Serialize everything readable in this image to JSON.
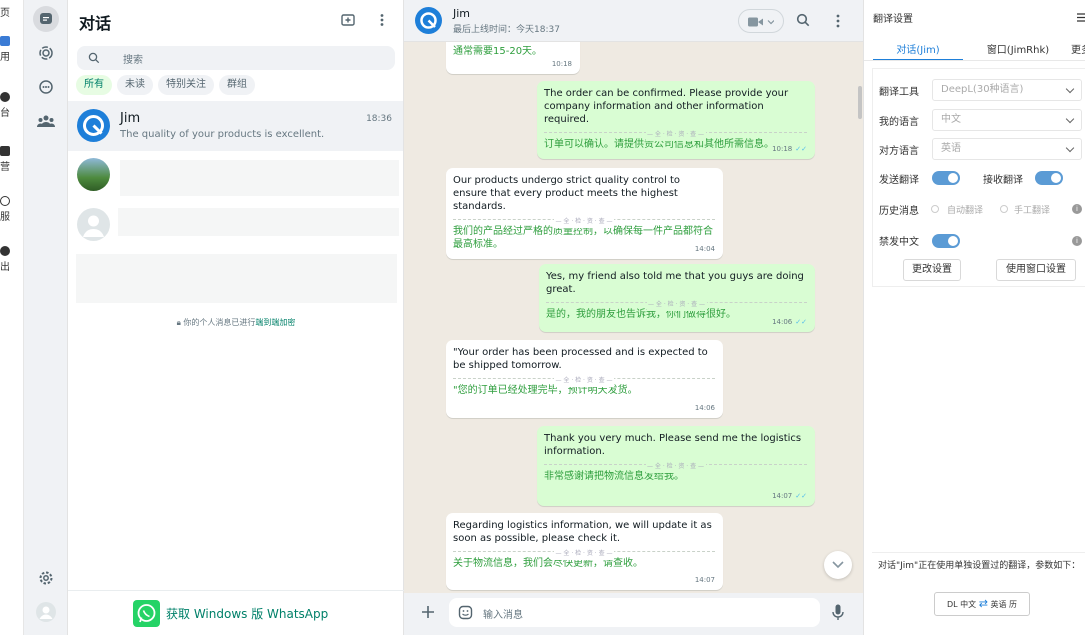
{
  "left_nav": {
    "items": [
      {
        "label": "页"
      },
      {
        "label": "用"
      },
      {
        "label": "台"
      },
      {
        "label": "营"
      },
      {
        "label": "服"
      },
      {
        "label": "出"
      }
    ]
  },
  "chat_list": {
    "title": "对话",
    "search_placeholder": "搜索",
    "filters": [
      "所有",
      "未读",
      "特别关注",
      "群组"
    ],
    "chats": [
      {
        "name": "Jim",
        "time": "18:36",
        "preview": "The quality of your products is excellent."
      }
    ],
    "encryption_note": "你的个人消息已进行",
    "encryption_link": "端到端加密",
    "download_label": "获取 Windows 版 WhatsApp"
  },
  "chat_header": {
    "name": "Jim",
    "status": "最后上线时间：今天18:37"
  },
  "messages": [
    {
      "dir": "in",
      "text": "",
      "translation": "通常需要15-20天。",
      "time": "10:18"
    },
    {
      "dir": "out",
      "text": "The order can be confirmed. Please provide your company information and other information required.",
      "translation": "订单可以确认。请提供贵公司信息和其他所需信息。",
      "time": "10:18"
    },
    {
      "dir": "in",
      "text": "Our products undergo strict quality control to ensure that every product meets the highest standards.",
      "translation": "我们的产品经过严格的质量控制，以确保每一件产品都符合最高标准。",
      "time": "14:04"
    },
    {
      "dir": "out",
      "text": "Yes, my friend also told me that you guys are doing great.",
      "translation": "是的，我的朋友也告诉我，你们做得很好。",
      "time": "14:06"
    },
    {
      "dir": "in",
      "text": "\"Your order has been processed and is expected to be shipped tomorrow.",
      "translation": "\"您的订单已经处理完毕，预计明天发货。",
      "time": "14:06"
    },
    {
      "dir": "out",
      "text": "Thank you very much. Please send me the logistics information.",
      "translation": "非常感谢请把物流信息发给我。",
      "time": "14:07"
    },
    {
      "dir": "in",
      "text": "Regarding logistics information, we will update it as soon as possible, please check it.",
      "translation": "关于物流信息，我们会尽快更新，请查收。",
      "time": "14:07"
    }
  ],
  "sep_label": "— 全 · 检 · 资 · 查 —",
  "compose": {
    "placeholder": "输入消息"
  },
  "translate_panel": {
    "title": "翻译设置",
    "tabs": [
      "对话(Jim)",
      "窗口(JimRhk)",
      "更多"
    ],
    "tool_label": "翻译工具",
    "tool_value": "DeepL(30种语言)",
    "my_lang_label": "我的语言",
    "my_lang_value": "中文",
    "their_lang_label": "对方语言",
    "their_lang_value": "英语",
    "send_translate_label": "发送翻译",
    "recv_translate_label": "接收翻译",
    "history_label": "历史消息",
    "auto_label": "自动翻译",
    "manual_label": "手工翻译",
    "ban_cn_label": "禁发中文",
    "change_btn": "更改设置",
    "use_window_btn": "使用窗口设置",
    "footer_note": "对话\"Jim\"正在使用单独设置过的翻译，参数如下：",
    "footer_pill": {
      "from": "DL 中文",
      "to": "英语 历"
    }
  },
  "colors": {
    "accent": "#008069",
    "bubble_out": "#d9fdd3",
    "chat_bg": "#efeae2",
    "translation": "#2e9e3d",
    "toggle": "#5b9bd5"
  }
}
